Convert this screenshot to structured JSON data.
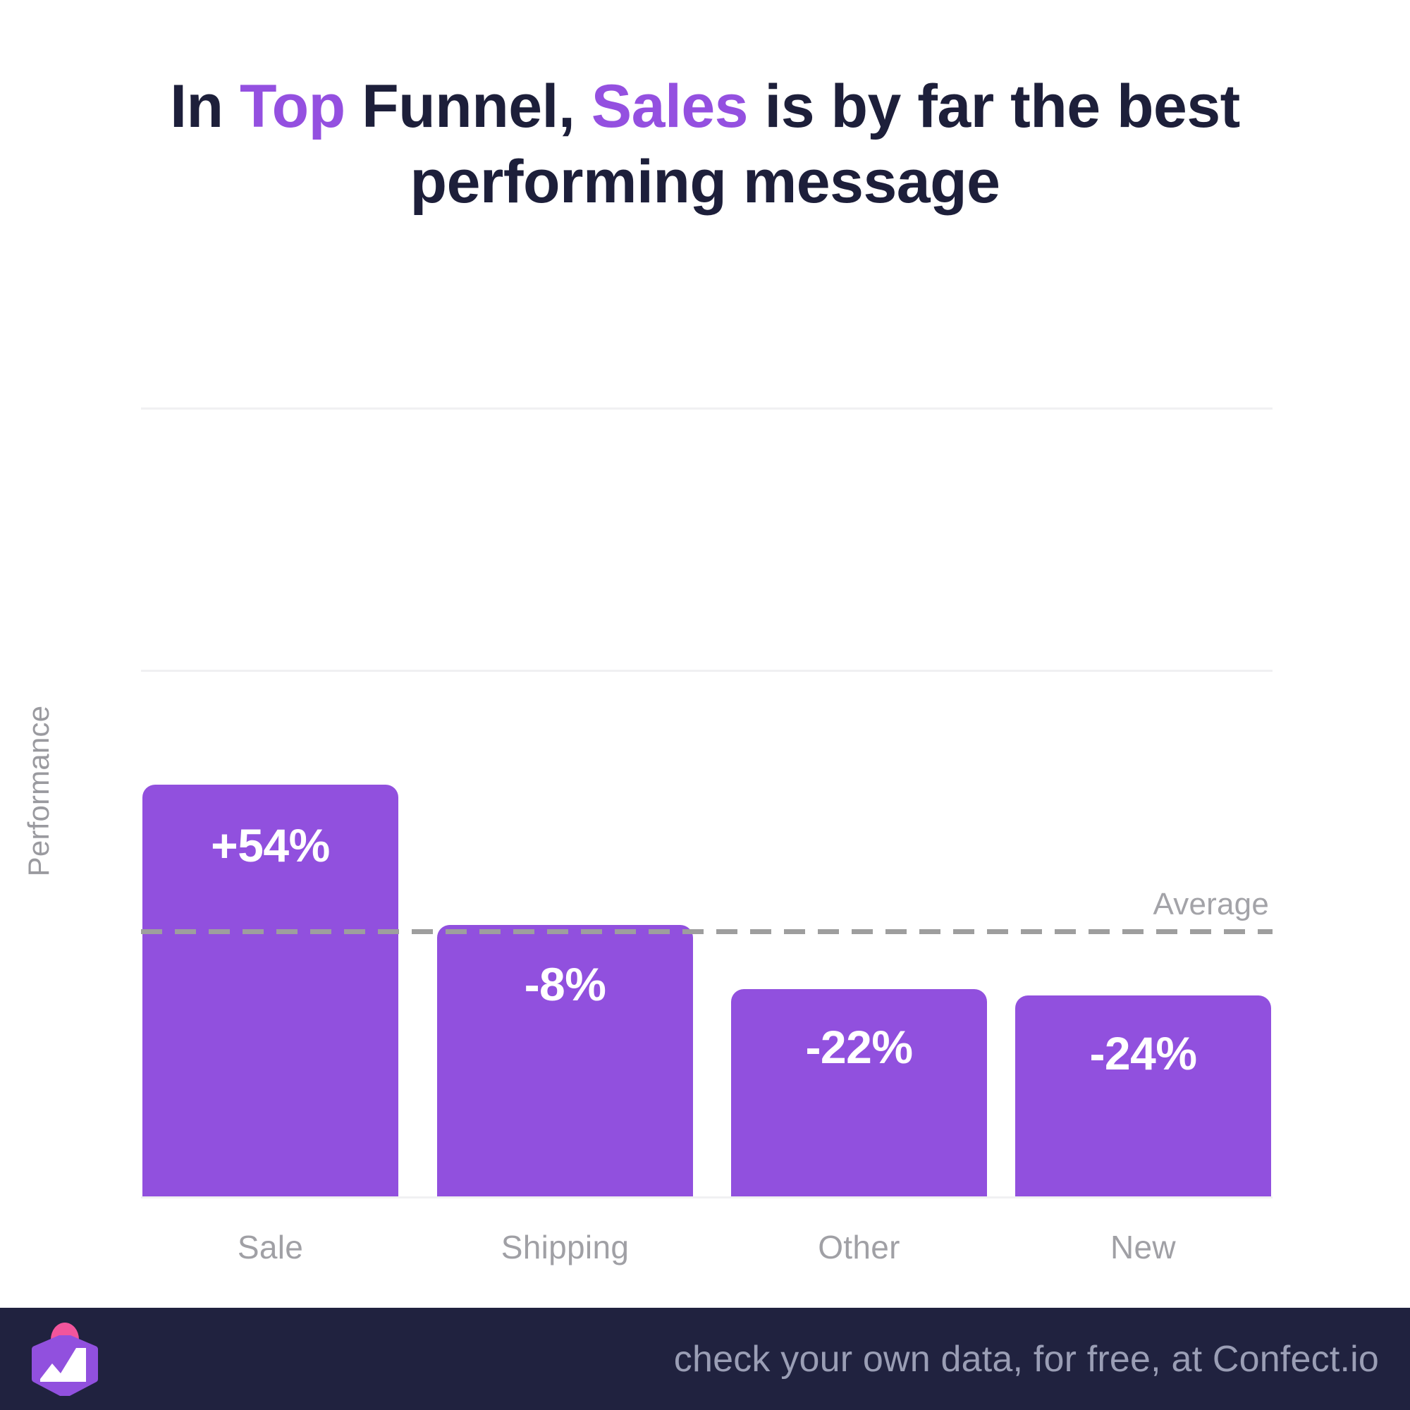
{
  "title": {
    "part1": "In ",
    "hl1": "Top",
    "part2": " Funnel, ",
    "hl2": "Sales",
    "part3": " is by far the best performing message"
  },
  "colors": {
    "bar": "#9150de",
    "title_text": "#1d1f3a",
    "title_highlight": "#9450e0",
    "axis_text": "#a0a0a5",
    "average_line": "#9e9e9e",
    "footer_bg": "#20223f",
    "footer_text": "#9a9eb5",
    "grid": "#f0f0f2",
    "logo_purple": "#9150de",
    "logo_pink": "#f2559c"
  },
  "chart_data": {
    "type": "bar",
    "title": "In Top Funnel, Sales is by far the best performing message",
    "xlabel": "",
    "ylabel": "Performance",
    "categories": [
      "Sale",
      "Shipping",
      "Other",
      "New"
    ],
    "values": [
      54,
      -8,
      -22,
      -24
    ],
    "value_labels": [
      "+54%",
      "-8%",
      "-22%",
      "-24%"
    ],
    "annotations": [
      {
        "name": "average",
        "label": "Average",
        "style": "dashed-horizontal-line",
        "value": 0
      }
    ],
    "grid": true,
    "legend": "none",
    "ylim": [
      -35,
      90
    ]
  },
  "footer": {
    "text": "check your own data, for free, at Confect.io",
    "logo_name": "confect-logo"
  }
}
